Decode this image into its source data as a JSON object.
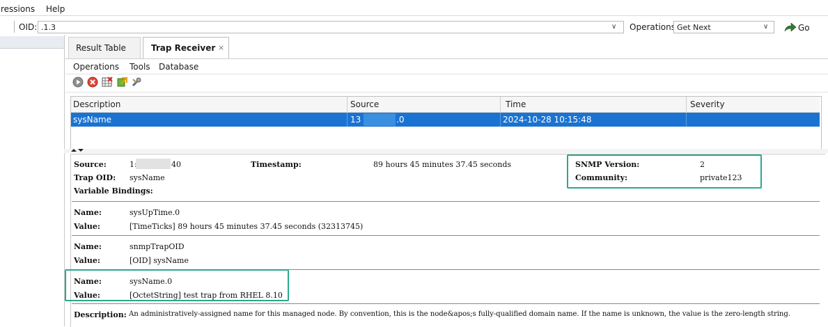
{
  "menubar": {
    "items": [
      "ressions",
      "Help"
    ]
  },
  "oid_bar": {
    "oid_label": "OID:",
    "oid_value": ".1.3",
    "operations_label": "Operations:",
    "operations_value": "Get Next",
    "go_label": "Go"
  },
  "tabs": [
    {
      "label": "Result Table",
      "active": false
    },
    {
      "label": "Trap Receiver",
      "active": true,
      "close": "×"
    }
  ],
  "submenu": {
    "items": [
      "Operations",
      "Tools",
      "Database"
    ]
  },
  "toolbar": {
    "icons": [
      "start-icon",
      "stop-icon",
      "clear-table-icon",
      "export-icon",
      "settings-icon"
    ]
  },
  "table": {
    "columns": [
      "Description",
      "Source",
      "Time",
      "Severity"
    ],
    "rows": [
      {
        "description": "sysName",
        "source_prefix": "13",
        "source_suffix": ".0",
        "time": "2024-10-28 10:15:48",
        "severity": ""
      }
    ]
  },
  "detail": {
    "source_label": "Source:",
    "source_prefix": "1:",
    "source_suffix": "40",
    "timestamp_label": "Timestamp:",
    "timestamp_value": "89 hours 45 minutes 37.45 seconds",
    "snmp_version_label": "SNMP Version:",
    "snmp_version_value": "2",
    "trap_oid_label": "Trap OID:",
    "trap_oid_value": "sysName",
    "community_label": "Community:",
    "community_value": "private123",
    "varbinds_label": "Variable Bindings:",
    "bindings": [
      {
        "name_label": "Name:",
        "name": "sysUpTime.0",
        "value_label": "Value:",
        "value": "[TimeTicks] 89 hours 45 minutes 37.45 seconds (32313745)"
      },
      {
        "name_label": "Name:",
        "name": "snmpTrapOID",
        "value_label": "Value:",
        "value": "[OID] sysName"
      },
      {
        "name_label": "Name:",
        "name": "sysName.0",
        "value_label": "Value:",
        "value": "[OctetString] test trap from RHEL 8.10"
      }
    ],
    "description_label": "Description:",
    "description_value": "An administratively-assigned name for this managed node. By convention, this is the node&apos;s fully-qualified domain name. If the name is unknown, the value is the zero-length string."
  },
  "colors": {
    "selection": "#1a73d1",
    "highlight_box": "#2aa98c",
    "go_arrow": "#2e7d32"
  }
}
